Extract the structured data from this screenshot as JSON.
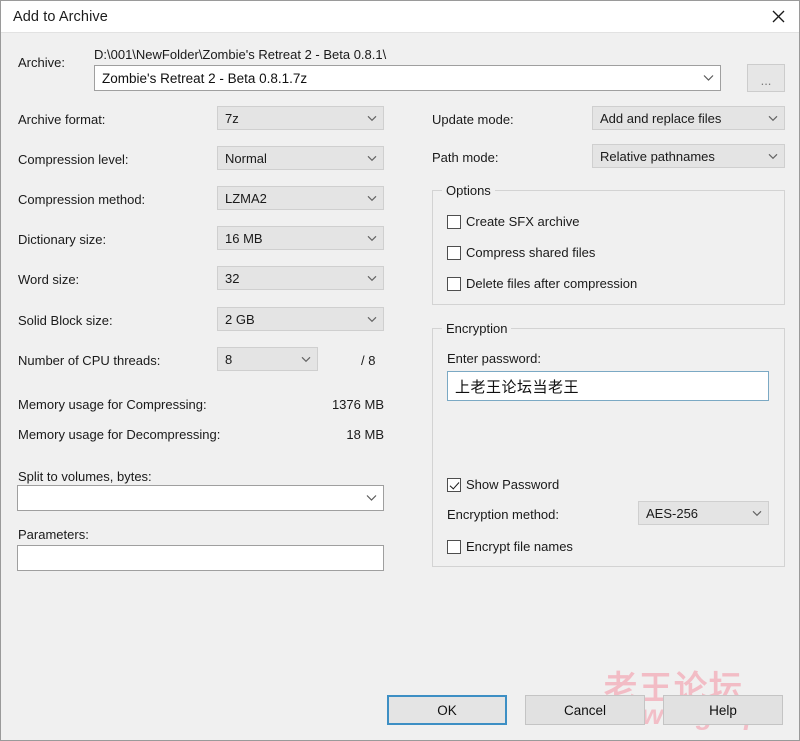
{
  "window": {
    "title": "Add to Archive",
    "close_icon": "close-icon"
  },
  "archive": {
    "label": "Archive:",
    "path_text": "D:\\001\\NewFolder\\Zombie's Retreat 2 - Beta 0.8.1\\",
    "name_value": "Zombie's Retreat 2 - Beta 0.8.1.7z",
    "browse_label": "..."
  },
  "left": {
    "archive_format": {
      "label": "Archive format:",
      "value": "7z"
    },
    "compression_level": {
      "label": "Compression level:",
      "value": "Normal"
    },
    "compression_method": {
      "label": "Compression method:",
      "value": "LZMA2"
    },
    "dictionary_size": {
      "label": "Dictionary size:",
      "value": "16 MB"
    },
    "word_size": {
      "label": "Word size:",
      "value": "32"
    },
    "solid_block_size": {
      "label": "Solid Block size:",
      "value": "2 GB"
    },
    "cpu_threads": {
      "label": "Number of CPU threads:",
      "value": "8",
      "total": "/ 8"
    },
    "mem_compress": {
      "label": "Memory usage for Compressing:",
      "value": "1376 MB"
    },
    "mem_decompress": {
      "label": "Memory usage for Decompressing:",
      "value": "18 MB"
    },
    "split_volumes": {
      "label": "Split to volumes, bytes:",
      "value": ""
    },
    "parameters": {
      "label": "Parameters:",
      "value": ""
    }
  },
  "right": {
    "update_mode": {
      "label": "Update mode:",
      "value": "Add and replace files"
    },
    "path_mode": {
      "label": "Path mode:",
      "value": "Relative pathnames"
    },
    "options": {
      "title": "Options",
      "items": [
        {
          "label": "Create SFX archive",
          "checked": false
        },
        {
          "label": "Compress shared files",
          "checked": false
        },
        {
          "label": "Delete files after compression",
          "checked": false
        }
      ]
    },
    "encryption": {
      "title": "Encryption",
      "password_label": "Enter password:",
      "password_value": "上老王论坛当老王",
      "show_password": {
        "label": "Show Password",
        "checked": true
      },
      "method_label": "Encryption method:",
      "method_value": "AES-256",
      "encrypt_names": {
        "label": "Encrypt file names",
        "checked": false
      }
    }
  },
  "buttons": {
    "ok": "OK",
    "cancel": "Cancel",
    "help": "Help"
  },
  "watermark": {
    "cn": "老王论坛",
    "en": "laowang.vip",
    "color": "#f3b8c2"
  },
  "colors": {
    "dialog_bg": "#f0f0f0",
    "titlebar_bg": "#ffffff",
    "combo_bg": "#e4e4e4",
    "focus_blue": "#3d8fc4",
    "field_focus_border": "#7ba9c4"
  }
}
